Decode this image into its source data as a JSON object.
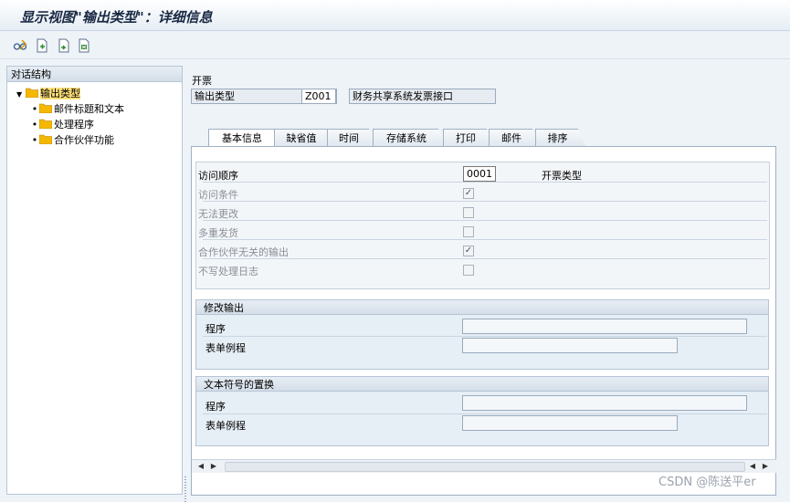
{
  "window": {
    "title": "显示视图\"输出类型\"：详细信息"
  },
  "toolbar": {
    "icons": [
      "glasses-toggle-icon",
      "new-entries-icon",
      "copy-icon",
      "delete-icon"
    ]
  },
  "tree": {
    "header": "对话结构",
    "items": [
      {
        "label": "输出类型",
        "level": 0,
        "expanded": true,
        "selected": true
      },
      {
        "label": "邮件标题和文本",
        "level": 1
      },
      {
        "label": "处理程序",
        "level": 1
      },
      {
        "label": "合作伙伴功能",
        "level": 1
      }
    ]
  },
  "header": {
    "application_label": "开票",
    "output_type_label": "输出类型",
    "output_type_value": "Z001",
    "output_type_desc": "财务共享系统发票接口"
  },
  "tabs": [
    {
      "label": "基本信息",
      "active": true
    },
    {
      "label": "缺省值"
    },
    {
      "label": "时间"
    },
    {
      "label": "存储系统"
    },
    {
      "label": "打印"
    },
    {
      "label": "邮件"
    },
    {
      "label": "排序"
    }
  ],
  "basic": {
    "access_seq_label": "访问顺序",
    "access_seq_value": "0001",
    "access_seq_desc": "开票类型",
    "options": [
      {
        "label": "访问条件",
        "checked": true
      },
      {
        "label": "无法更改",
        "checked": false
      },
      {
        "label": "多重发货",
        "checked": false
      },
      {
        "label": "合作伙伴无关的输出",
        "checked": true
      },
      {
        "label": "不写处理日志",
        "checked": false
      }
    ]
  },
  "modify_output": {
    "title": "修改输出",
    "program_label": "程序",
    "program_value": "",
    "form_routine_label": "表单例程",
    "form_routine_value": ""
  },
  "text_replace": {
    "title": "文本符号的置换",
    "program_label": "程序",
    "program_value": "",
    "form_routine_label": "表单例程",
    "form_routine_value": ""
  },
  "watermark": "CSDN @陈送平er",
  "colors": {
    "selected_bg": "#ffe07a",
    "folder": "#f5b800",
    "title": "#1a2a44"
  }
}
